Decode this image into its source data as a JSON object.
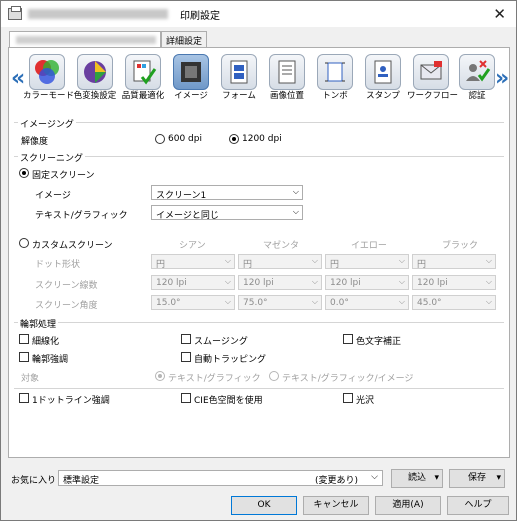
{
  "title": "印刷設定",
  "tabs": [
    "詳細設定"
  ],
  "icons": [
    {
      "label": "カラーモード",
      "icon": "color-mode-icon"
    },
    {
      "label": "色変換設定",
      "icon": "color-conversion-icon"
    },
    {
      "label": "品質最適化",
      "icon": "quality-optimize-icon"
    },
    {
      "label": "イメージ",
      "icon": "image-icon"
    },
    {
      "label": "フォーム",
      "icon": "form-icon"
    },
    {
      "label": "画像位置",
      "icon": "image-position-icon"
    },
    {
      "label": "トンボ",
      "icon": "crop-mark-icon"
    },
    {
      "label": "スタンプ",
      "icon": "stamp-icon"
    },
    {
      "label": "ワークフロー",
      "icon": "workflow-icon"
    },
    {
      "label": "認証",
      "icon": "auth-icon"
    }
  ],
  "imaging": {
    "group": "イメージング",
    "resolution_label": "解像度",
    "dpi600": "600 dpi",
    "dpi1200": "1200 dpi"
  },
  "screening": {
    "group": "スクリーニング",
    "fixed": "固定スクリーン",
    "image_label": "イメージ",
    "image_value": "スクリーン1",
    "text_label": "テキスト/グラフィック",
    "text_value": "イメージと同じ",
    "custom": "カスタムスクリーン",
    "cols": [
      "シアン",
      "マゼンタ",
      "イエロー",
      "ブラック"
    ],
    "rows": [
      {
        "label": "ドット形状",
        "values": [
          "円",
          "円",
          "円",
          "円"
        ]
      },
      {
        "label": "スクリーン線数",
        "values": [
          "120 lpi",
          "120 lpi",
          "120 lpi",
          "120 lpi"
        ]
      },
      {
        "label": "スクリーン角度",
        "values": [
          "15.0°",
          "75.0°",
          "0.0°",
          "45.0°"
        ]
      }
    ]
  },
  "outline": {
    "group": "輪郭処理",
    "thin": "細線化",
    "smoothing": "スムージング",
    "color_char": "色文字補正",
    "emphasis": "輪郭強調",
    "trapping": "自動トラッピング",
    "target": "対象",
    "t1": "テキスト/グラフィック",
    "t2": "テキスト/グラフィック/イメージ"
  },
  "opts": {
    "dotline": "1ドットライン強調",
    "cie": "CIE色空間を使用",
    "gloss": "光沢"
  },
  "bottom": {
    "fav_label": "お気に入り",
    "fav_value": "標準設定",
    "fav_changed": "(変更あり)",
    "read": "読込",
    "save": "保存"
  },
  "buttons": {
    "ok": "OK",
    "cancel": "キャンセル",
    "apply": "適用(A)",
    "help": "ヘルプ"
  }
}
